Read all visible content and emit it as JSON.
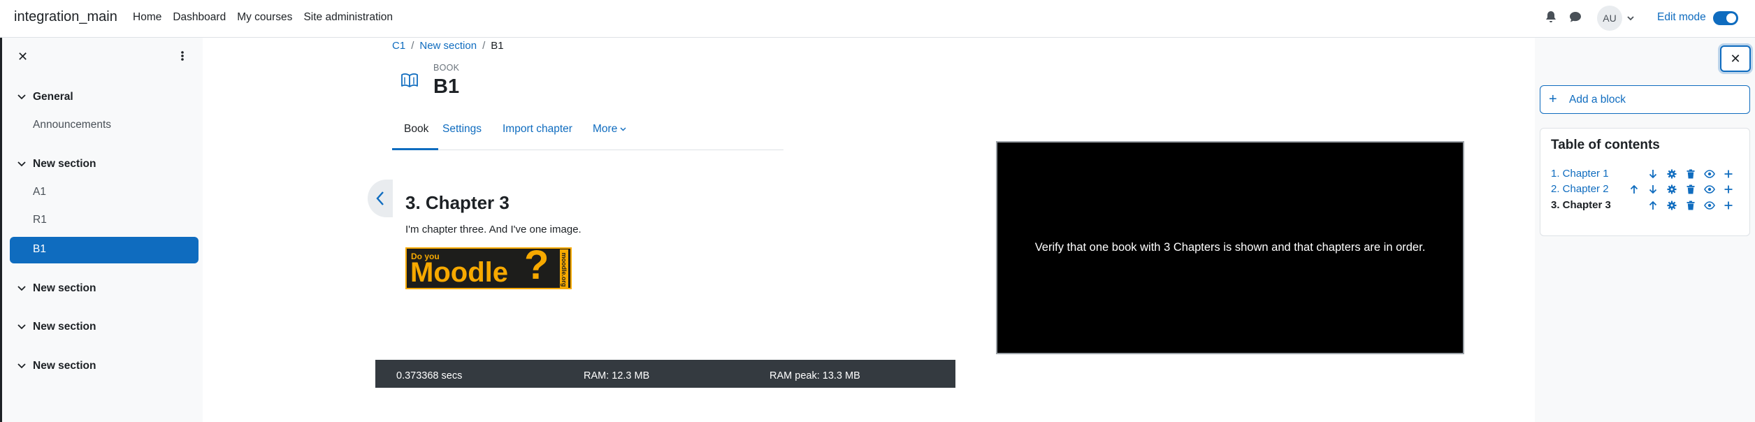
{
  "navbar": {
    "site_name": "integration_main",
    "links": [
      "Home",
      "Dashboard",
      "My courses",
      "Site administration"
    ],
    "avatar_initials": "AU",
    "edit_mode_label": "Edit mode",
    "edit_mode_on": true
  },
  "course_index": {
    "sections": [
      {
        "title": "General",
        "items": [
          "Announcements"
        ]
      },
      {
        "title": "New section",
        "items": [
          "A1",
          "R1",
          "B1"
        ],
        "active_item": "B1"
      },
      {
        "title": "New section",
        "items": []
      },
      {
        "title": "New section",
        "items": []
      },
      {
        "title": "New section",
        "items": []
      }
    ]
  },
  "breadcrumb": {
    "items": [
      "C1",
      "New section",
      "B1"
    ]
  },
  "header": {
    "kicker": "BOOK",
    "title": "B1"
  },
  "tabs": [
    {
      "label": "Book",
      "active": true
    },
    {
      "label": "Settings"
    },
    {
      "label": "Import chapter"
    },
    {
      "label": "More"
    }
  ],
  "chapter": {
    "title": "3. Chapter 3",
    "text": "I'm chapter three. And I've one image.",
    "image": {
      "line1": "Do you",
      "line2": "Moodle",
      "symbol": "?",
      "side": "moodle.org"
    }
  },
  "overlay": {
    "text": "Verify that one book with 3 Chapters is shown and that chapters are in order."
  },
  "footer": {
    "time": "0.373368 secs",
    "ram": "RAM: 12.3 MB",
    "ram_peak": "RAM peak: 13.3 MB"
  },
  "right_drawer": {
    "add_block_label": "Add a block",
    "toc": {
      "title": "Table of contents",
      "chapters": [
        {
          "label": "1. Chapter 1",
          "current": false
        },
        {
          "label": "2. Chapter 2",
          "current": false
        },
        {
          "label": "3. Chapter 3",
          "current": true
        }
      ]
    }
  },
  "colors": {
    "accent": "#0f6cbf",
    "text": "#1d2125",
    "muted": "#6a737b",
    "footer": "#343a40",
    "moodle_orange": "#f7a900"
  },
  "icons": [
    "bell-icon",
    "chat-icon",
    "chevron-down-icon",
    "close-icon",
    "kebab-icon",
    "book-icon",
    "chevron-left-icon",
    "plus-icon",
    "arrow-up-icon",
    "arrow-down-icon",
    "gear-icon",
    "trash-icon",
    "eye-icon"
  ]
}
